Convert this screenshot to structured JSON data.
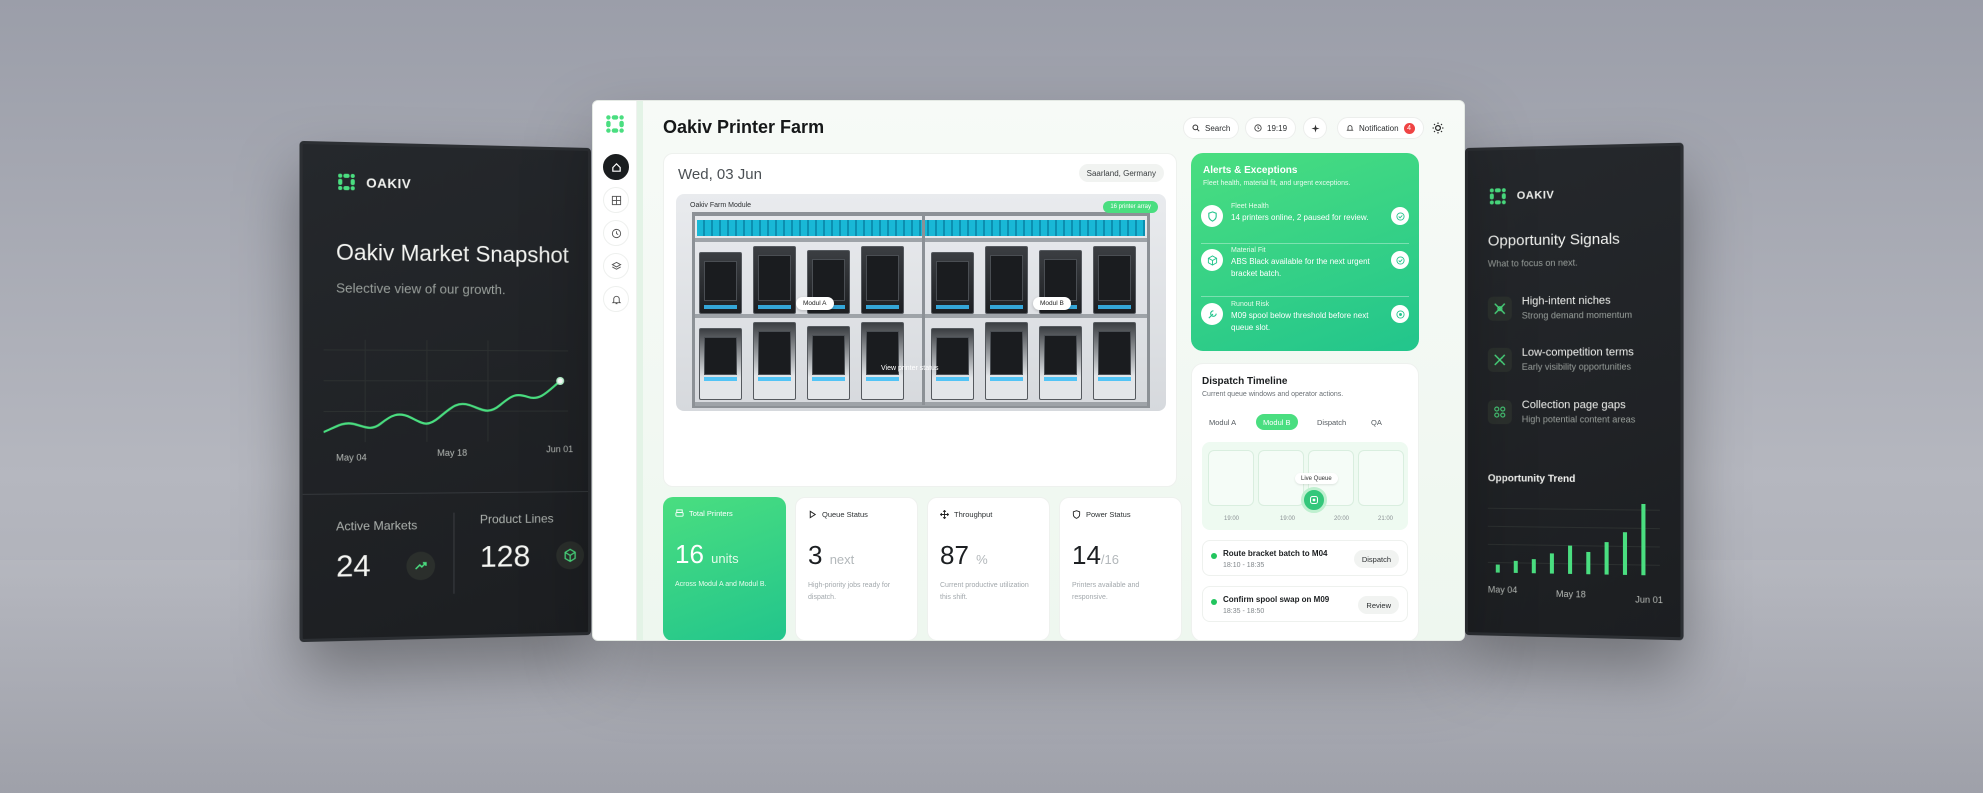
{
  "brand_name": "OAKIV",
  "market_snapshot": {
    "title": "Oakiv Market Snapshot",
    "subtitle": "Selective view of our growth.",
    "x_labels": [
      "May 04",
      "May 18",
      "Jun 01"
    ],
    "stats": [
      {
        "label": "Active Markets",
        "value": "24"
      },
      {
        "label": "Product Lines",
        "value": "128"
      }
    ]
  },
  "opportunity": {
    "title": "Opportunity Signals",
    "subtitle": "What to focus on next.",
    "items": [
      {
        "title": "High-intent niches",
        "subtitle": "Strong demand momentum"
      },
      {
        "title": "Low-competition terms",
        "subtitle": "Early visibility opportunities"
      },
      {
        "title": "Collection page gaps",
        "subtitle": "High potential content areas"
      }
    ],
    "trend_title": "Opportunity Trend",
    "trend_x_labels": [
      "May 04",
      "May 18",
      "Jun 01"
    ]
  },
  "app": {
    "title": "Oakiv Printer Farm",
    "search_label": "Search",
    "time": "19:19",
    "notification_label": "Notification",
    "notification_count": "4",
    "date": "Wed, 03 Jun",
    "location": "Saarland, Germany",
    "module_label": "Oakiv Farm Module",
    "array_tag": "16 printer array",
    "modul_a": "Modul A",
    "modul_b": "Modul B",
    "view_status": "View printer status"
  },
  "alerts": {
    "title": "Alerts & Exceptions",
    "subtitle": "Fleet health, material fit, and urgent exceptions.",
    "items": [
      {
        "kind": "Fleet Health",
        "text": "14 printers online, 2 paused for review."
      },
      {
        "kind": "Material Fit",
        "text": "ABS Black available for the next urgent bracket batch."
      },
      {
        "kind": "Runout Risk",
        "text": "M09 spool below threshold before next queue slot."
      }
    ]
  },
  "dispatch": {
    "title": "Dispatch Timeline",
    "subtitle": "Current queue windows and operator actions.",
    "tabs": [
      "Modul A",
      "Modul B",
      "Dispatch",
      "QA"
    ],
    "active_tab": "Modul B",
    "live_label": "Live Queue",
    "times": [
      "19:00",
      "19:00",
      "20:00",
      "21:00"
    ],
    "jobs": [
      {
        "title": "Route bracket batch to M04",
        "time": "18:10 - 18:35",
        "action": "Dispatch"
      },
      {
        "title": "Confirm spool swap on M09",
        "time": "18:35 - 18:50",
        "action": "Review"
      }
    ]
  },
  "stats": [
    {
      "label": "Total Printers",
      "value": "16",
      "unit": "units",
      "desc": "Across Modul A and Modul B."
    },
    {
      "label": "Queue Status",
      "value": "3",
      "unit": "next",
      "desc": "High-priority jobs ready for dispatch."
    },
    {
      "label": "Throughput",
      "value": "87",
      "unit": "%",
      "desc": "Current productive utilization this shift."
    },
    {
      "label": "Power Status",
      "value": "14",
      "unit": "/16",
      "desc": "Printers available and responsive."
    }
  ],
  "colors": {
    "accent": "#4ade80",
    "accent_dark": "#22c58c",
    "panel_dark": "#1f2225",
    "badge_red": "#ef4444"
  },
  "icons": {
    "rail": [
      "home-icon",
      "grid-icon",
      "clock-icon",
      "layers-icon",
      "bell-icon"
    ],
    "topbar": [
      "search-icon",
      "clock-icon",
      "sparkle-icon",
      "bell-icon",
      "sun-icon"
    ]
  }
}
